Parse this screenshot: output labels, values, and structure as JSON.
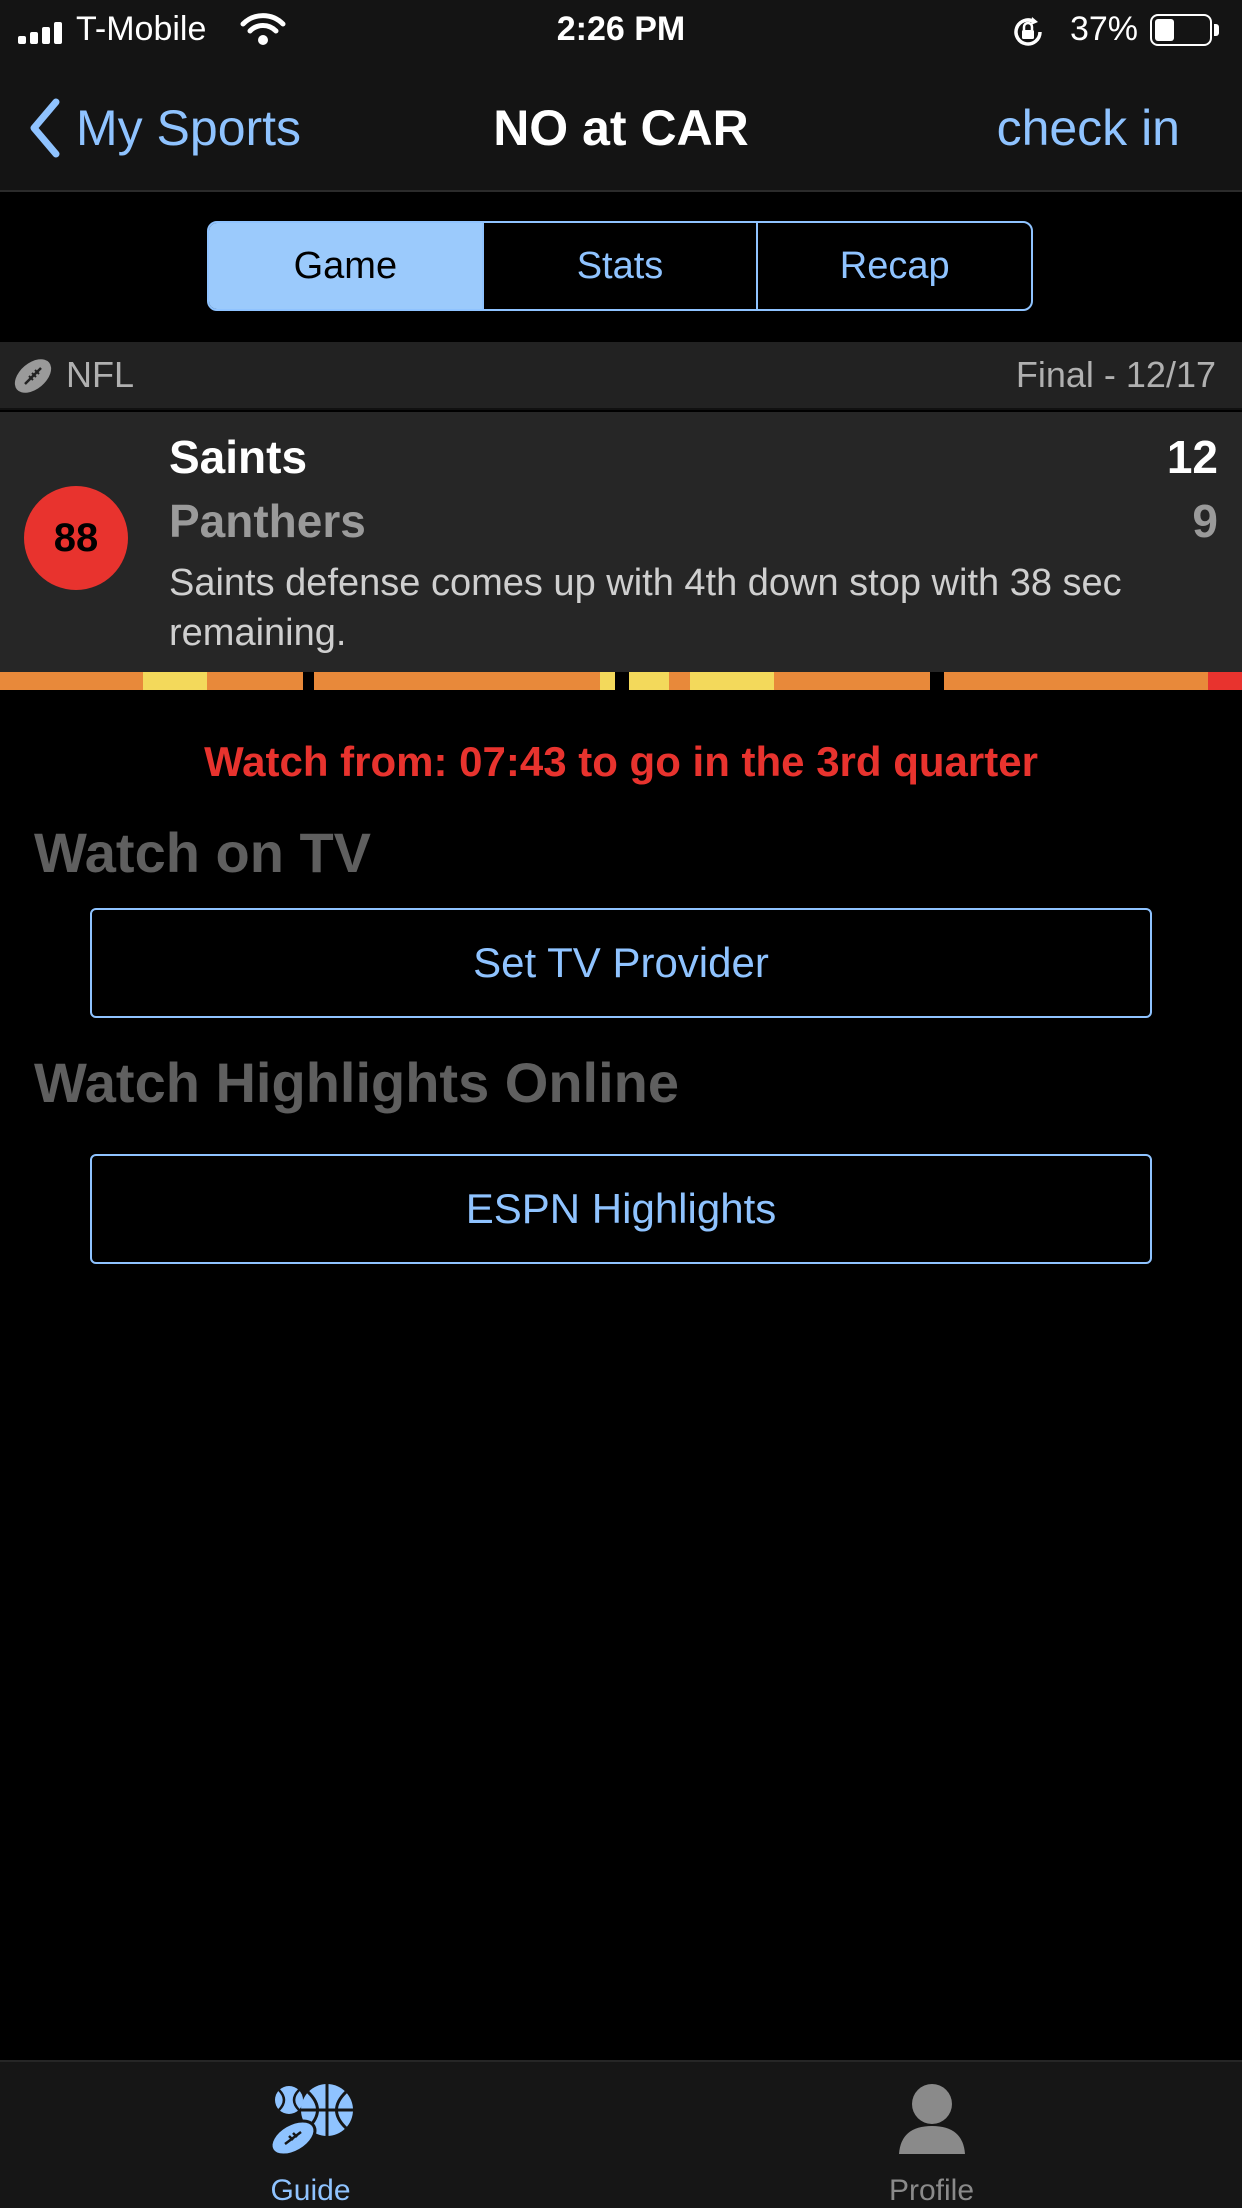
{
  "status_bar": {
    "carrier": "T-Mobile",
    "time": "2:26 PM",
    "battery_percent": "37%",
    "battery_level": 0.37
  },
  "nav": {
    "back_label": "My Sports",
    "title": "NO at CAR",
    "right_action": "check in"
  },
  "segments": {
    "items": [
      "Game",
      "Stats",
      "Recap"
    ],
    "selected": "Game"
  },
  "league": {
    "name": "NFL",
    "status": "Final - 12/17"
  },
  "game": {
    "rating": "88",
    "team1": {
      "name": "Saints",
      "score": "12"
    },
    "team2": {
      "name": "Panthers",
      "score": "9"
    },
    "summary": "Saints defense comes up with 4th down stop with 38 sec remaining."
  },
  "watch": {
    "watch_from": "Watch from: 07:43 to go in the 3rd quarter",
    "tv_title": "Watch on TV",
    "tv_button": "Set TV Provider",
    "highlights_title": "Watch Highlights Online",
    "highlights_button": "ESPN Highlights"
  },
  "tabbar": {
    "guide_label": "Guide",
    "profile_label": "Profile",
    "active": "Guide"
  },
  "colors": {
    "accent": "#8fc3ff",
    "segment_active": "#9bcafc",
    "alert": "#e8332e",
    "heat_orange": "#e8893a",
    "heat_yellow": "#f3d95b",
    "heat_red": "#e8332e"
  }
}
